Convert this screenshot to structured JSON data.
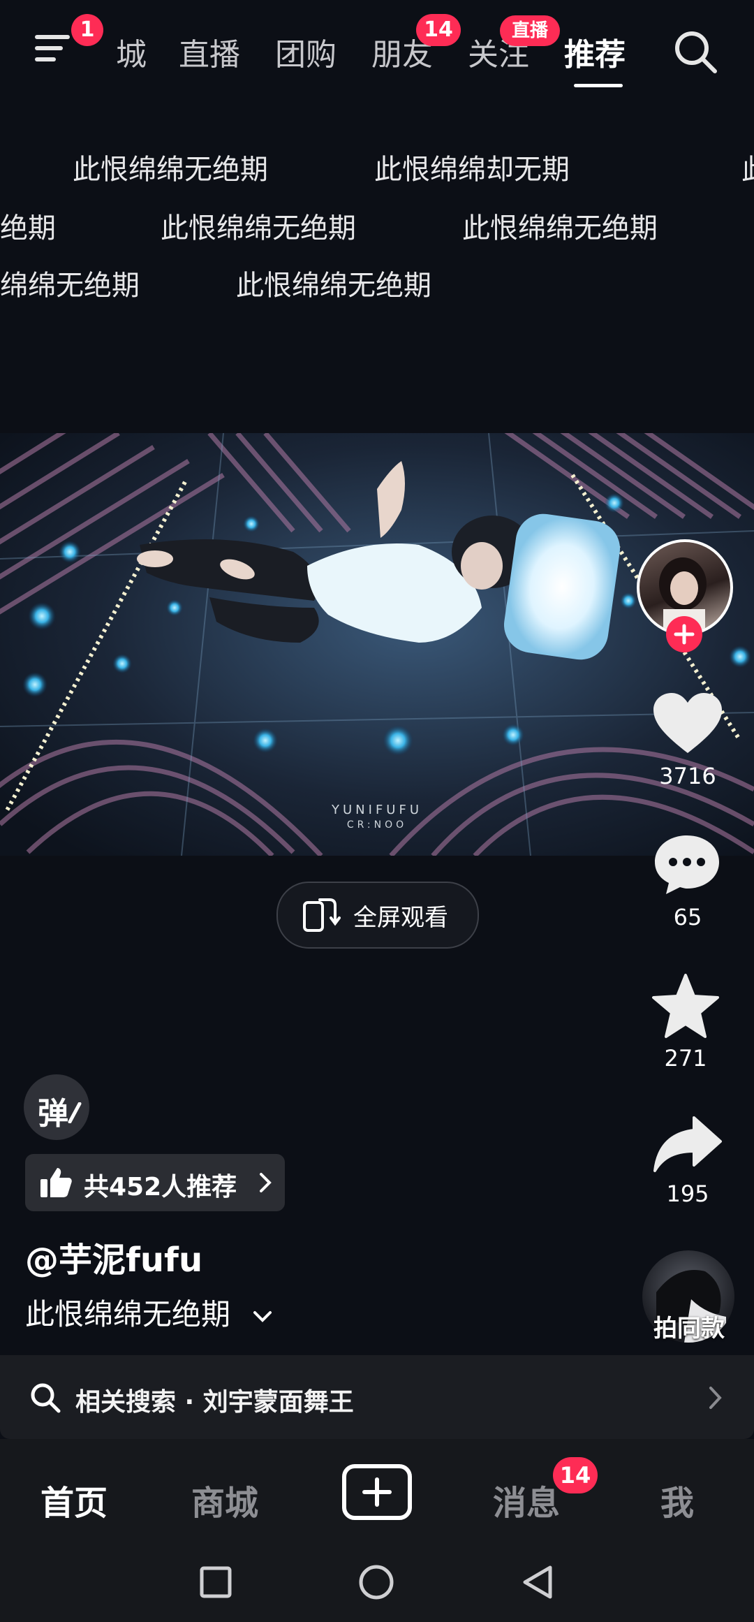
{
  "top_nav": {
    "menu_badge": "1",
    "tabs": [
      {
        "label": "城"
      },
      {
        "label": "直播"
      },
      {
        "label": "团购"
      },
      {
        "label": "朋友"
      },
      {
        "label": "关注"
      },
      {
        "label": "推荐"
      }
    ],
    "friends_badge": "14",
    "follow_badge": "直播",
    "active_tab": "推荐"
  },
  "danmaku": [
    "此恨绵绵无绝期",
    "此恨绵绵却无期",
    "此",
    "无绝期",
    "此恨绵绵无绝期",
    "此恨绵绵无绝期",
    "绵绵无绝期",
    "此恨绵绵无绝期"
  ],
  "video": {
    "watermark_line1": "YUNIFUFU",
    "watermark_line2": "CR:NOO"
  },
  "fullscreen": {
    "label": "全屏观看"
  },
  "actions": {
    "likes": "3716",
    "comments": "65",
    "favorites": "271",
    "shares": "195",
    "same_style": "拍同款"
  },
  "danmu_toggle": "弹",
  "recommend_pill": "共452人推荐",
  "author": "@芋泥fufu",
  "description": "此恨绵绵无绝期",
  "related_search": "相关搜索 · 刘宇蒙面舞王",
  "bottom_tabs": {
    "home": "首页",
    "mall": "商城",
    "messages": "消息",
    "messages_badge": "14",
    "me": "我"
  },
  "colors": {
    "accent": "#fe2c55",
    "background": "#0c0f16",
    "tabbar": "#16181c"
  }
}
